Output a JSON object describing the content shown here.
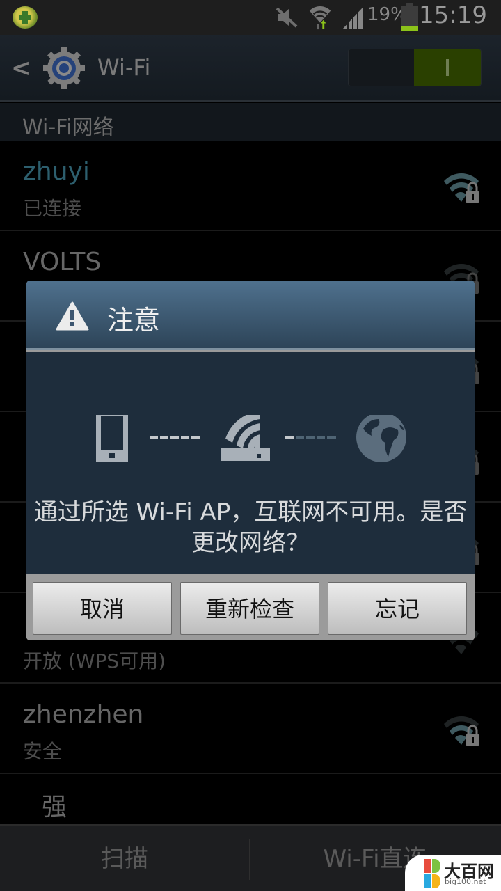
{
  "status_bar": {
    "app_icon": "360-security-icon",
    "icons": [
      "mute-icon",
      "wifi-data-activity-icon",
      "cell-signal-icon"
    ],
    "battery_percent_label": "19%",
    "battery_level": 0.19,
    "time": "15:19"
  },
  "action_bar": {
    "back_icon": "chevron-left-icon",
    "settings_icon": "gear-icon",
    "title": "Wi-Fi",
    "wifi_toggle": {
      "state": "on",
      "on_color": "#2a4000"
    }
  },
  "section_header": "Wi-Fi网络",
  "networks": [
    {
      "ssid": "zhuyi",
      "status": "已连接",
      "secured": true,
      "connected": true
    },
    {
      "ssid": "VOLTS",
      "status": "",
      "secured": true,
      "connected": false
    },
    {
      "ssid": "",
      "status": "",
      "secured": true,
      "connected": false
    },
    {
      "ssid": "",
      "status": "",
      "secured": true,
      "connected": false
    },
    {
      "ssid": "",
      "status": "",
      "secured": true,
      "connected": false
    },
    {
      "ssid": "",
      "status": "开放 (WPS可用)",
      "secured": false,
      "connected": false
    },
    {
      "ssid": "zhenzhen",
      "status": "安全",
      "secured": true,
      "connected": false
    },
    {
      "ssid": "强",
      "status": "",
      "secured": false,
      "connected": false
    }
  ],
  "bottom_bar": {
    "scan_label": "扫描",
    "wifi_direct_label": "Wi-Fi直连"
  },
  "dialog": {
    "title_icon": "warning-triangle-icon",
    "title": "注意",
    "illustration": [
      "phone-icon",
      "router-icon",
      "globe-icon"
    ],
    "message": "通过所选 Wi-Fi AP，互联网不可用。是否更改网络？",
    "buttons": {
      "cancel": "取消",
      "recheck": "重新检查",
      "forget": "忘记"
    }
  },
  "watermark": {
    "name": "大百网",
    "domain": "big100.net"
  }
}
